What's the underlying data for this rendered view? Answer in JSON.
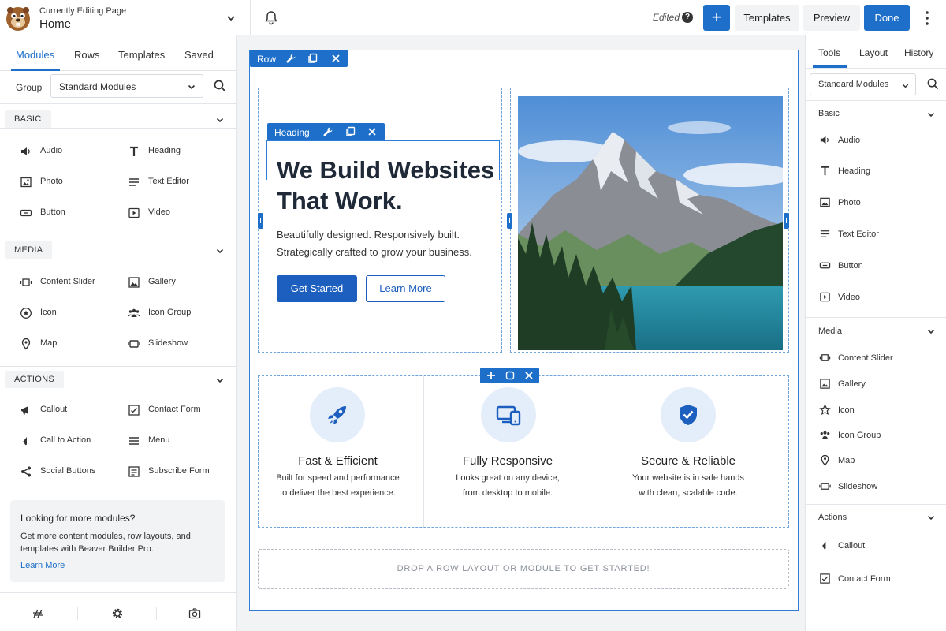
{
  "header": {
    "kicker": "Currently Editing Page",
    "page_name": "Home",
    "status": "Edited",
    "help_glyph": "?",
    "plus_glyph": "+",
    "templates_label": "Templates",
    "preview_label": "Preview",
    "done_label": "Done"
  },
  "left_panel": {
    "tabs": [
      "Modules",
      "Rows",
      "Templates",
      "Saved"
    ],
    "active_tab": "Modules",
    "group_label": "Group",
    "group_value": "Standard Modules",
    "sections": [
      {
        "title": "BASIC",
        "items": [
          {
            "label": "Audio",
            "icon": "audio-icon"
          },
          {
            "label": "Heading",
            "icon": "heading-icon"
          },
          {
            "label": "Photo",
            "icon": "photo-icon"
          },
          {
            "label": "Text Editor",
            "icon": "text-editor-icon"
          },
          {
            "label": "Button",
            "icon": "button-icon"
          },
          {
            "label": "Video",
            "icon": "video-icon"
          }
        ]
      },
      {
        "title": "MEDIA",
        "items": [
          {
            "label": "Content Slider",
            "icon": "slider-icon"
          },
          {
            "label": "Gallery",
            "icon": "gallery-icon"
          },
          {
            "label": "Icon",
            "icon": "star-icon"
          },
          {
            "label": "Icon Group",
            "icon": "icon-group-icon"
          },
          {
            "label": "Map",
            "icon": "map-pin-icon"
          },
          {
            "label": "Slideshow",
            "icon": "slideshow-icon"
          }
        ]
      },
      {
        "title": "ACTIONS",
        "items": [
          {
            "label": "Callout",
            "icon": "megaphone-icon"
          },
          {
            "label": "Contact Form",
            "icon": "contact-form-icon"
          },
          {
            "label": "Call to Action",
            "icon": "cta-icon"
          },
          {
            "label": "Menu",
            "icon": "menu-icon"
          },
          {
            "label": "Social Buttons",
            "icon": "share-icon"
          },
          {
            "label": "Subscribe Form",
            "icon": "subscribe-icon"
          }
        ]
      }
    ],
    "promo": {
      "title": "Looking for more modules?",
      "text": "Get more content modules, row layouts, and templates with Beaver Builder Pro.",
      "link": "Learn More"
    }
  },
  "canvas": {
    "row_toolbar_label": "Row",
    "heading_toolbar_label": "Heading",
    "hero": {
      "heading_line1": "We Build Websites",
      "heading_line2": "That Work.",
      "sub_line1": "Beautifully designed. Responsively built.",
      "sub_line2": "Strategically crafted to grow your business.",
      "primary_button": "Get Started",
      "secondary_button": "Learn More"
    },
    "features": [
      {
        "title": "Fast & Efficient",
        "line1": "Built for speed and performance",
        "line2": "to deliver the best experience.",
        "icon": "rocket-icon"
      },
      {
        "title": "Fully Responsive",
        "line1": "Looks great on any device,",
        "line2": "from desktop to mobile.",
        "icon": "devices-icon"
      },
      {
        "title": "Secure & Reliable",
        "line1": "Your website is in safe hands",
        "line2": "with clean, scalable code.",
        "icon": "shield-check-icon"
      }
    ],
    "dropzone": "DROP A ROW LAYOUT OR MODULE TO GET STARTED!"
  },
  "right_panel": {
    "tabs": [
      "Tools",
      "Layout",
      "History"
    ],
    "active_tab": "Tools",
    "group_value": "Standard Modules",
    "sections": [
      {
        "title": "Basic",
        "items": [
          "Audio",
          "Heading",
          "Photo",
          "Text Editor",
          "Button",
          "Video"
        ]
      },
      {
        "title": "Media",
        "items": [
          "Content Slider",
          "Gallery",
          "Icon",
          "Icon Group",
          "Map",
          "Slideshow"
        ]
      },
      {
        "title": "Actions",
        "items": [
          "Callout",
          "Contact Form"
        ]
      }
    ]
  },
  "colors": {
    "accent": "#1d6fc9",
    "primary_button": "#1d5fbf",
    "icon_circle": "#e4eefa"
  }
}
